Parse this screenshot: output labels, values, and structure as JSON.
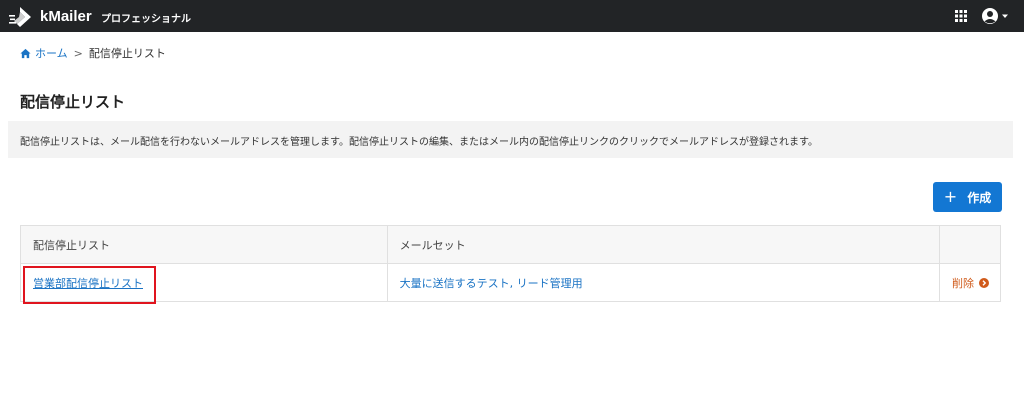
{
  "header": {
    "brand": "kMailer",
    "edition": "プロフェッショナル",
    "logo_icon": "kmailer-logo-icon",
    "apps_icon": "grid-icon",
    "user_icon": "user-avatar-icon",
    "background": "#222426"
  },
  "breadcrumb": {
    "home_label": "ホーム",
    "separator": ">",
    "current": "配信停止リスト"
  },
  "page": {
    "title": "配信停止リスト",
    "notice": "配信停止リストは、メール配信を行わないメールアドレスを管理します。配信停止リストの編集、またはメール内の配信停止リンクのクリックでメールアドレスが登録されます。"
  },
  "toolbar": {
    "create_label": "作成",
    "create_icon": "plus-icon",
    "accent": "#1377d3"
  },
  "table": {
    "headers": [
      "配信停止リスト",
      "メールセット",
      ""
    ],
    "rows": [
      {
        "name": "営業部配信停止リスト",
        "mailsets": "大量に送信するテスト, リード管理用",
        "delete_label": "削除"
      }
    ]
  },
  "annotation": {
    "highlight_color": "#e0141e"
  }
}
